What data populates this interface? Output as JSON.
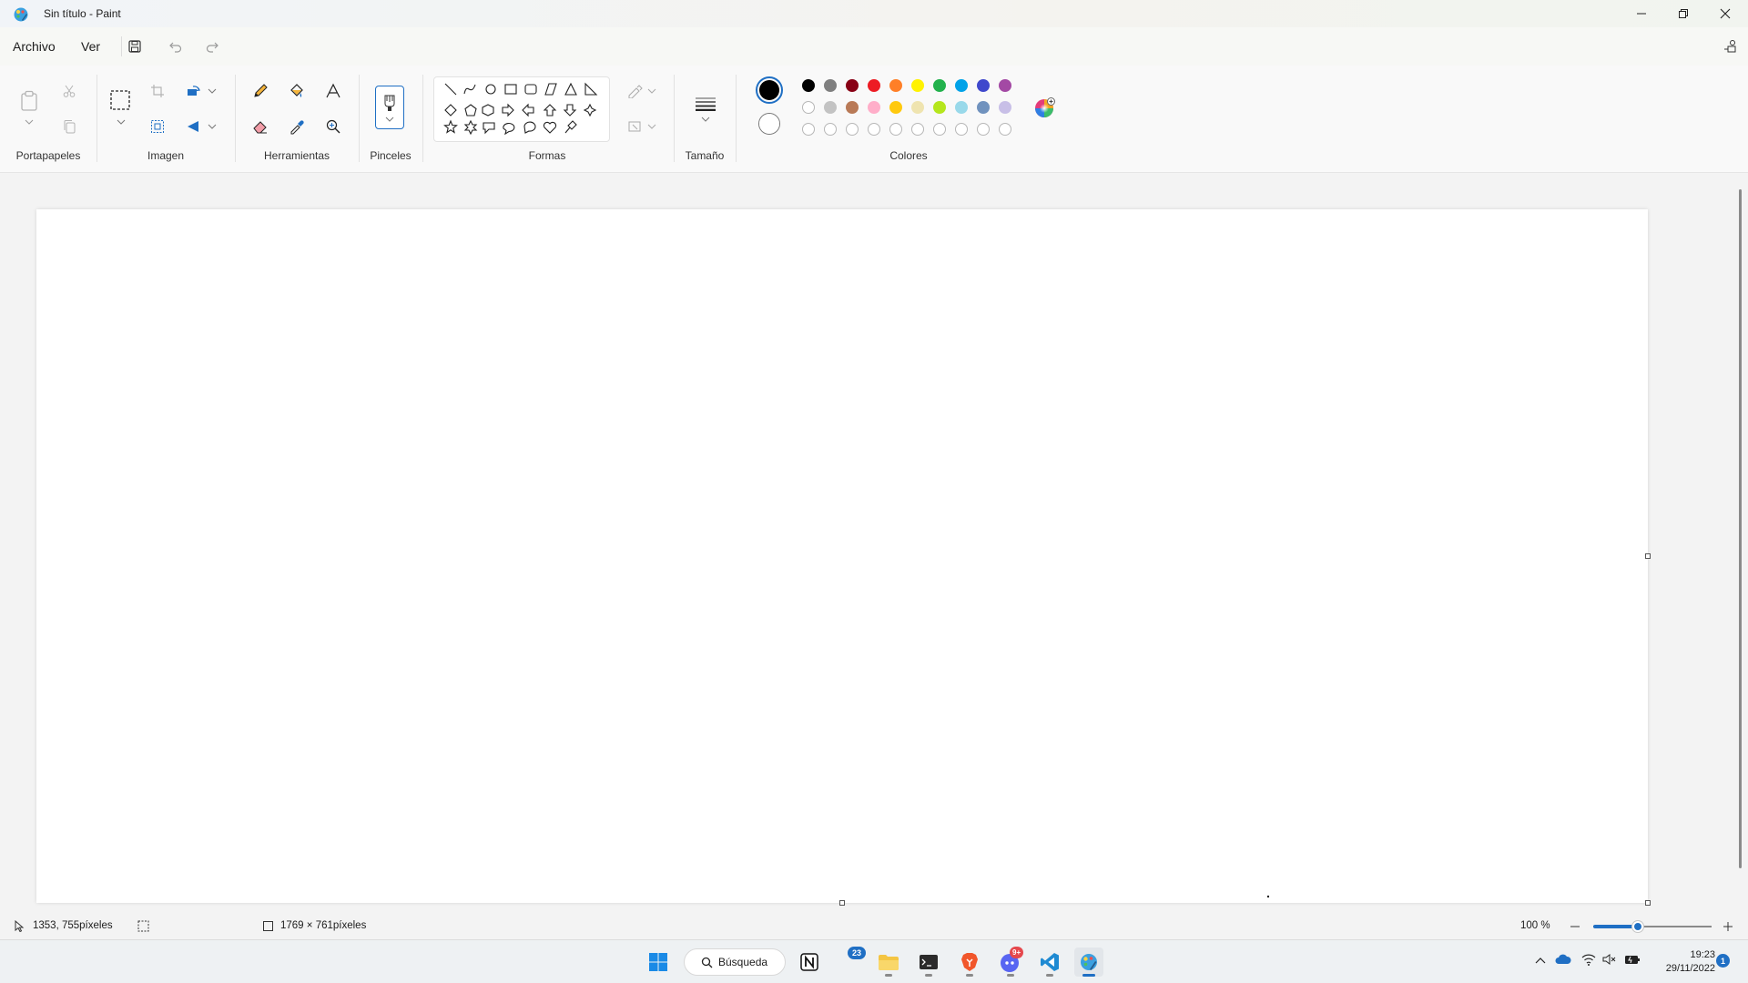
{
  "window": {
    "title": "Sin título - Paint",
    "app_icon": "paint-icon",
    "controls": [
      "minimize-icon",
      "restore-icon",
      "close-icon"
    ]
  },
  "menu": {
    "items": [
      "Archivo",
      "Ver"
    ],
    "icons": [
      "save-icon",
      "undo-icon",
      "redo-icon"
    ],
    "right_icon": "share-icon"
  },
  "ribbon": {
    "groups": [
      {
        "label": "Portapapeles"
      },
      {
        "label": "Imagen"
      },
      {
        "label": "Herramientas"
      },
      {
        "label": "Pinceles"
      },
      {
        "label": "Formas"
      },
      {
        "label": "Tamaño"
      },
      {
        "label": "Colores"
      }
    ],
    "colors": {
      "primary": "#000000",
      "secondary": "#ffffff",
      "row1": [
        "#000000",
        "#7f7f7f",
        "#880015",
        "#ed1c24",
        "#ff7f27",
        "#fff200",
        "#22b14c",
        "#00a2e8",
        "#3f48cc",
        "#a349a4"
      ],
      "row2": [
        "#ffffff",
        "#c3c3c3",
        "#b97a57",
        "#ffaec9",
        "#ffc90e",
        "#efe4b0",
        "#b5e61d",
        "#99d9ea",
        "#7092be",
        "#c8bfe7"
      ],
      "row3_empty_count": 10
    }
  },
  "status": {
    "cursor_pos": "1353, 755píxeles",
    "canvas_size": "1769 × 761píxeles",
    "zoom": "100 %",
    "zoom_level": 1.0
  },
  "taskbar": {
    "search_label": "Búsqueda",
    "mail_badge": "23",
    "discord_badge": "9+",
    "time": "19:23",
    "date": "29/11/2022",
    "notification_count": "1"
  }
}
